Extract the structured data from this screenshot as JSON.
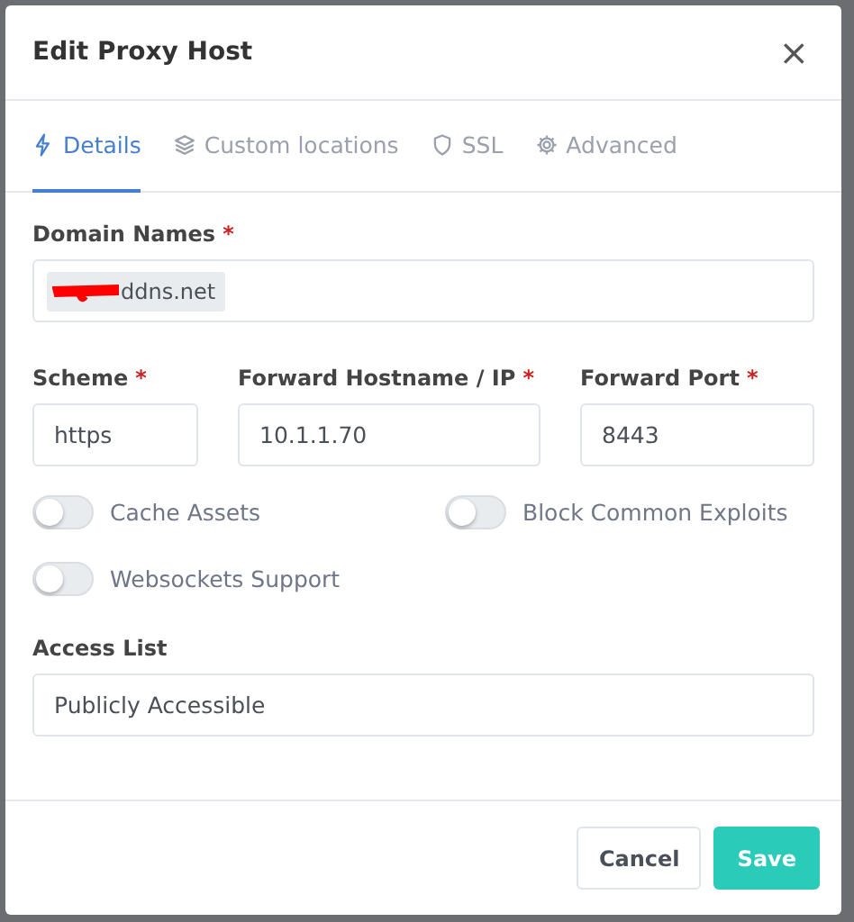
{
  "dialog": {
    "title": "Edit Proxy Host",
    "close": "×"
  },
  "tabs": [
    {
      "label": "Details",
      "selected": true
    },
    {
      "label": "Custom locations",
      "selected": false
    },
    {
      "label": "SSL",
      "selected": false
    },
    {
      "label": "Advanced",
      "selected": false
    }
  ],
  "domain_names": {
    "label": "Domain Names",
    "required_mark": "*",
    "chips": [
      {
        "text": "ddns.net",
        "redacted": true
      }
    ]
  },
  "fields": [
    {
      "label": "Scheme",
      "required_mark": "*",
      "value": "https"
    },
    {
      "label": "Forward Hostname / IP",
      "required_mark": "*",
      "value": "10.1.1.70"
    },
    {
      "label": "Forward Port",
      "required_mark": "*",
      "value": "8443"
    }
  ],
  "toggles": [
    {
      "label": "Cache Assets",
      "on": false
    },
    {
      "label": "Block Common Exploits",
      "on": false
    },
    {
      "label": "Websockets Support",
      "on": false
    }
  ],
  "access_list": {
    "label": "Access List",
    "value": "Publicly Accessible"
  },
  "buttons": [
    {
      "label": "Cancel",
      "kind": "secondary"
    },
    {
      "label": "Save",
      "kind": "primary"
    }
  ]
}
